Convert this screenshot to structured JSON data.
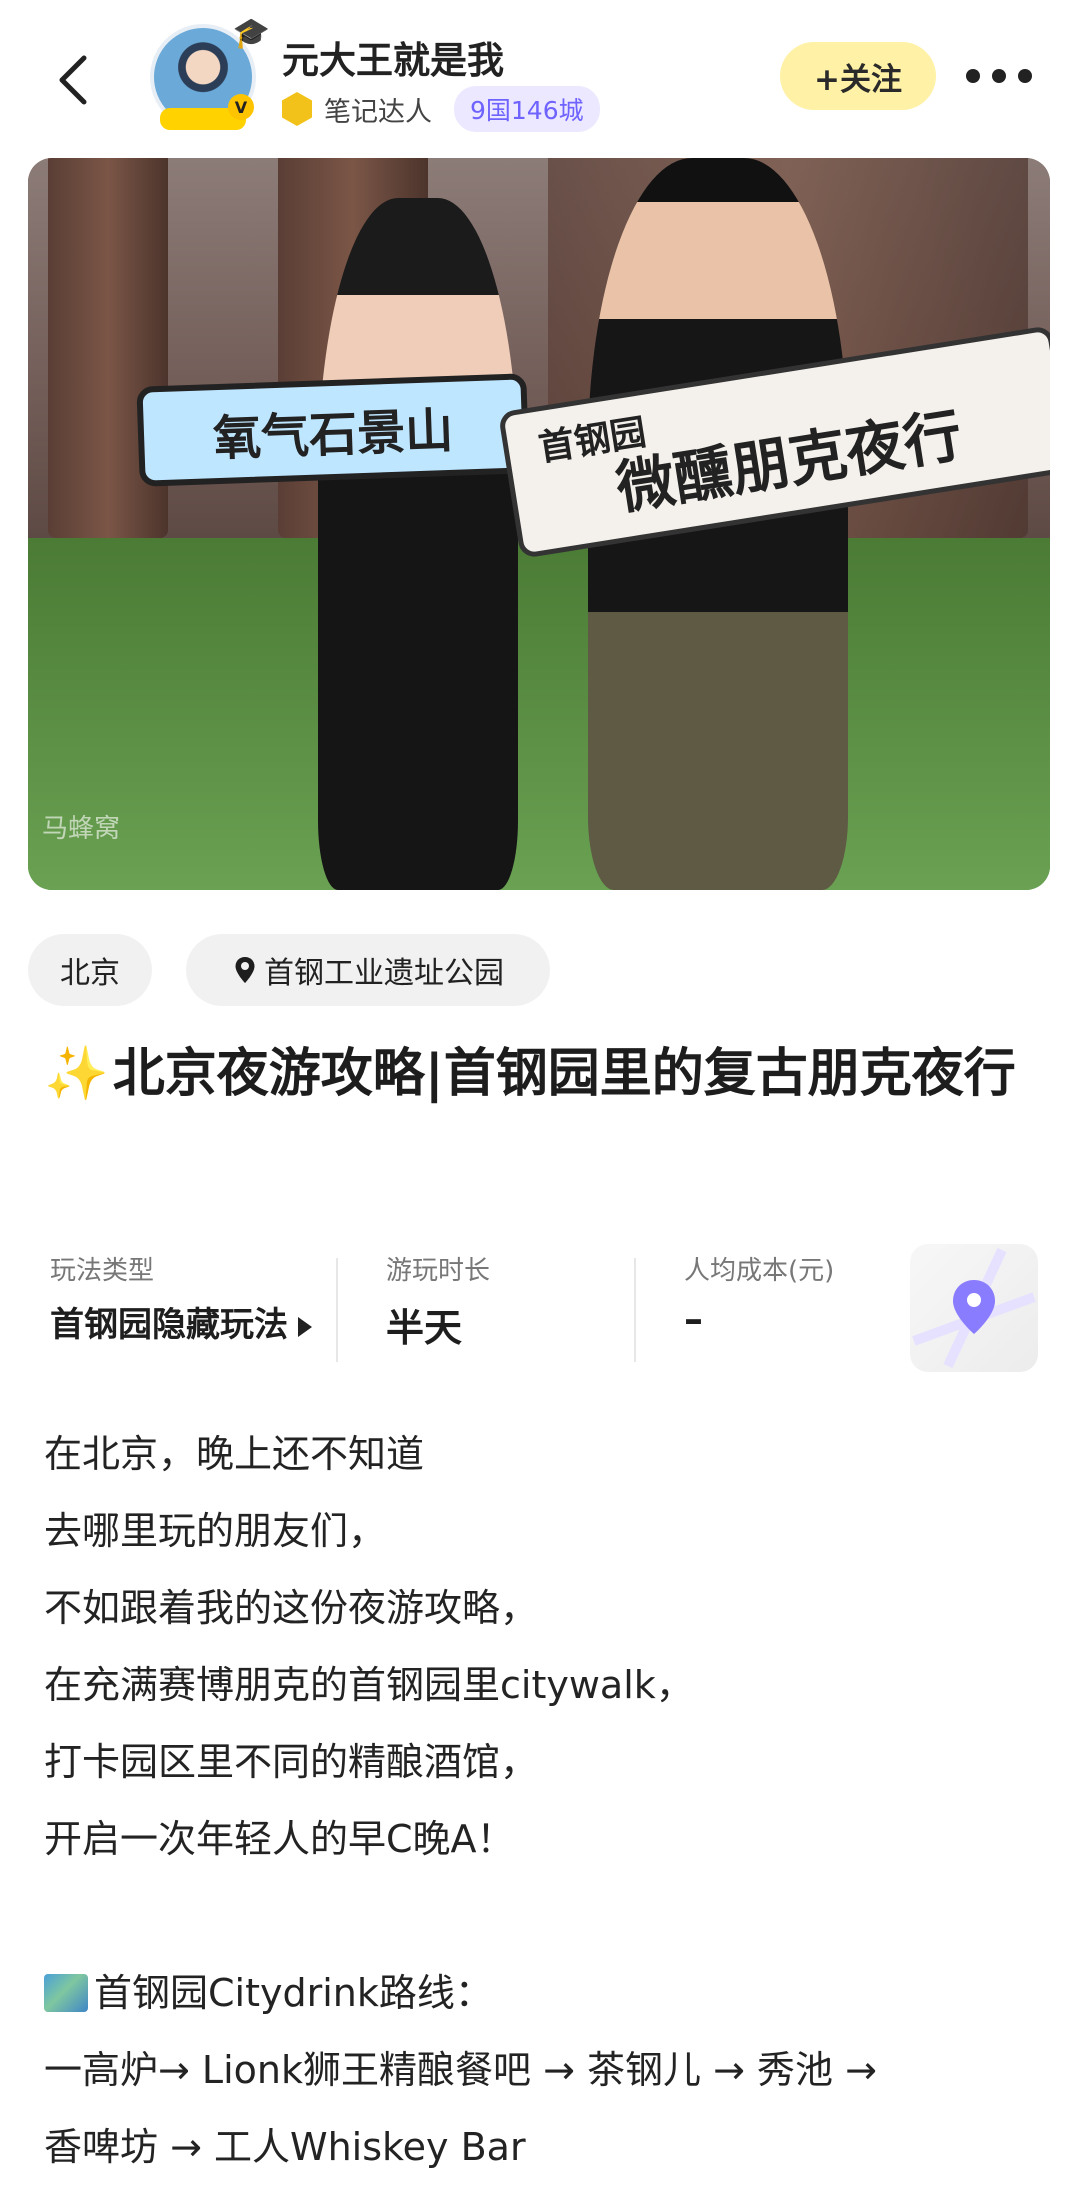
{
  "header": {
    "username": "元大王就是我",
    "level_label": "笔记达人",
    "travel_tag": "9国146城",
    "follow_label": "+关注"
  },
  "photo": {
    "sign_left": "氧气石景山",
    "sign_right_small": "首钢园",
    "sign_right_main": "微醺朋克夜行",
    "watermark": "马蜂窝"
  },
  "location": {
    "city": "北京",
    "poi": "首钢工业遗址公园"
  },
  "title": "北京夜游攻略|首钢园里的复古朋克夜行",
  "title_prefix_emoji": "✨",
  "info": {
    "play_type_label": "玩法类型",
    "play_type_value": "首钢园隐藏玩法",
    "duration_label": "游玩时长",
    "duration_value": "半天",
    "cost_label": "人均成本(元)",
    "cost_value": "–"
  },
  "body": {
    "lines": [
      "在北京，晚上还不知道",
      "去哪里玩的朋友们，",
      "不如跟着我的这份夜游攻略，",
      "在充满赛博朋克的首钢园里citywalk，",
      "打卡园区里不同的精酿酒馆，",
      "开启一次年轻人的早C晚A！"
    ],
    "route_heading": "首钢园Citydrink路线：",
    "route_line1": "一高炉→ Lionk狮王精酿餐吧 → 茶钢儿 → 秀池 →",
    "route_line2": "香啤坊 → 工人Whiskey Bar"
  },
  "colors": {
    "follow_bg": "#fff1a5",
    "tag_bg": "#ece8ff",
    "tag_text": "#6f63ff",
    "level_hex": "#f2c21b"
  }
}
